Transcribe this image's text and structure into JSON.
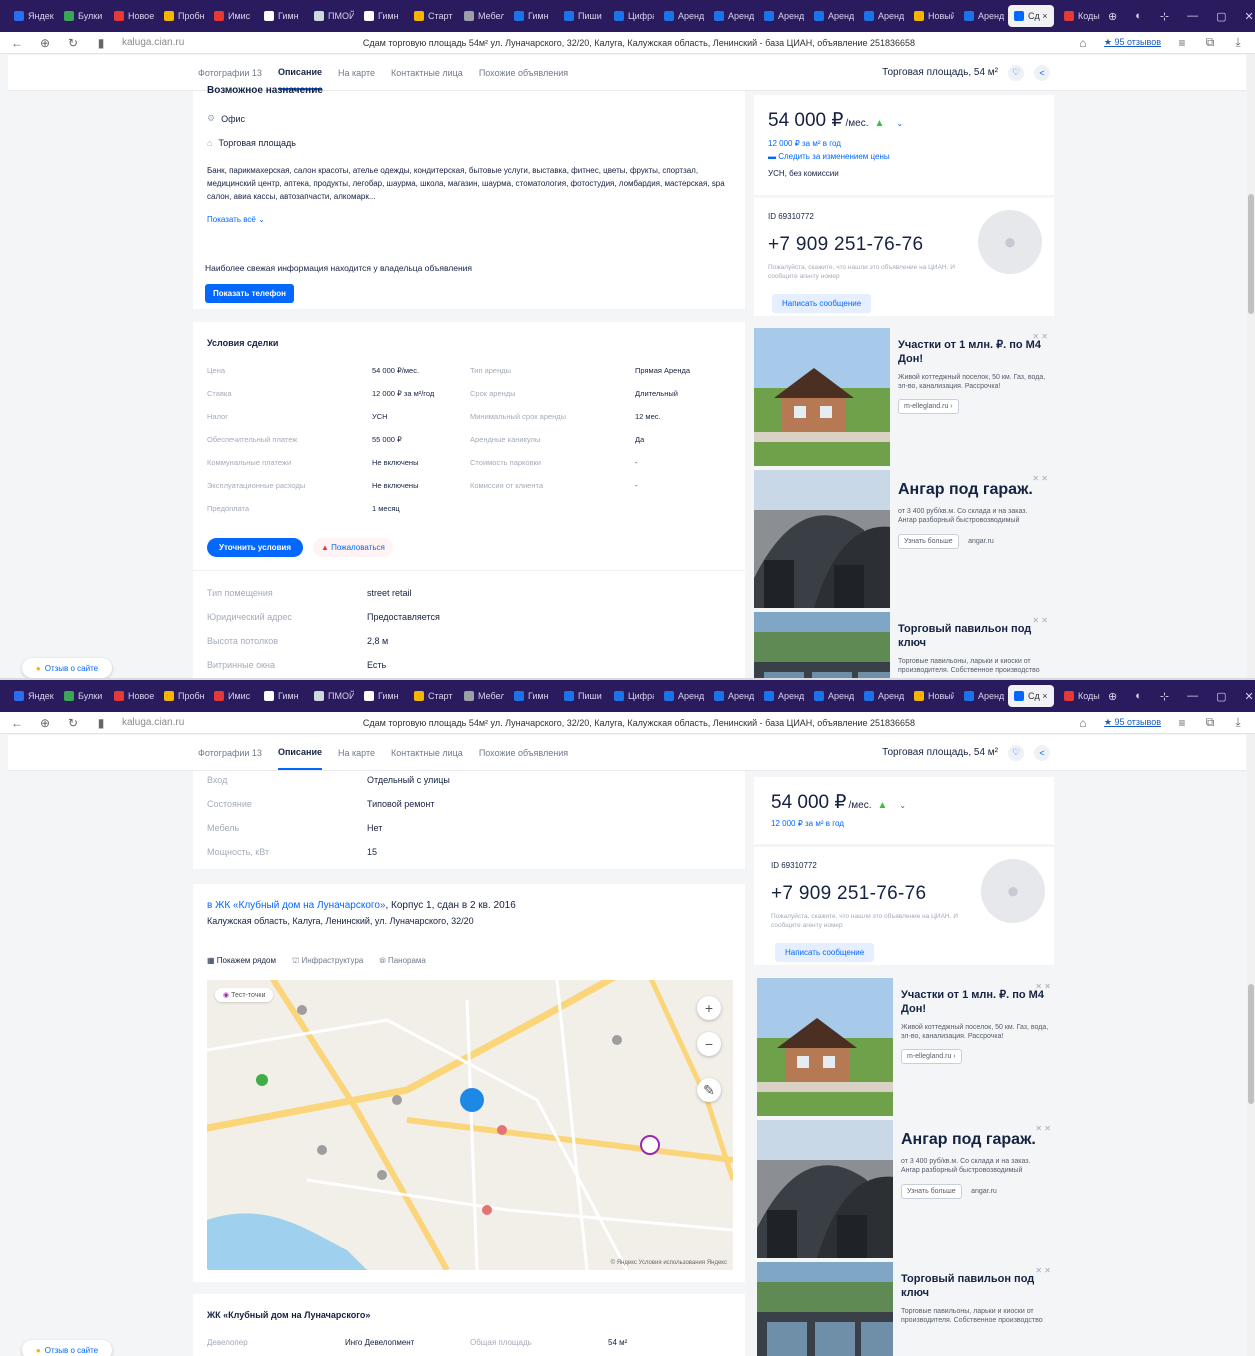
{
  "browser": {
    "tabs": [
      {
        "label": "Яндекс",
        "color": "#2b6ef0"
      },
      {
        "label": "Булки",
        "color": "#3aa757"
      },
      {
        "label": "Новое",
        "color": "#e53935"
      },
      {
        "label": "Пробнуй",
        "color": "#f5b400"
      },
      {
        "label": "Имис",
        "color": "#e53935"
      },
      {
        "label": "Гимн",
        "color": "#ffffff"
      },
      {
        "label": "ПМОЙ",
        "color": "#cfd8dc"
      },
      {
        "label": "Гимн",
        "color": "#ffffff"
      },
      {
        "label": "Старт",
        "color": "#f5b400"
      },
      {
        "label": "Мебель",
        "color": "#9aa0a6"
      },
      {
        "label": "Гимн",
        "color": "#1a73e8"
      },
      {
        "label": "Пиши",
        "color": "#1a73e8"
      },
      {
        "label": "Цифра",
        "color": "#1a73e8"
      },
      {
        "label": "Аренд",
        "color": "#1a73e8"
      },
      {
        "label": "Аренд",
        "color": "#1a73e8"
      },
      {
        "label": "Аренд",
        "color": "#1a73e8"
      },
      {
        "label": "Аренд",
        "color": "#1a73e8"
      },
      {
        "label": "Аренд",
        "color": "#1a73e8"
      },
      {
        "label": "Новый",
        "color": "#f5b400"
      },
      {
        "label": "Аренд",
        "color": "#1a73e8"
      },
      {
        "label": "Сд ×",
        "color": "#0468ff",
        "active": true
      },
      {
        "label": "Коды",
        "color": "#e53935"
      }
    ],
    "url_host": "kaluga.cian.ru",
    "page_title": "Сдам торговую площадь 54м² ул. Луначарского, 32/20, Калуга, Калужская область, Ленинский - база ЦИАН, объявление 251836658",
    "reviews_link": "★ 95 отзывов"
  },
  "nav": {
    "links": [
      "Фотографии 13",
      "Описание",
      "На карте",
      "Контактные лица",
      "Похожие объявления"
    ],
    "active_index": 1,
    "object_title": "Торговая площадь, 54 м²"
  },
  "top": {
    "section_heading": "Возможное назначение",
    "purpose_items": [
      {
        "icon": "office-icon",
        "label": "Офис"
      },
      {
        "icon": "shop-icon",
        "label": "Торговая площадь"
      }
    ],
    "purpose_text": "Банк, парикмахерская, салон красоты, ателье одежды, кондитерская, бытовые услуги, выставка, фитнес, цветы, фрукты, спортзал, медицинский центр, аптека, продукты, легобар, шаурма, школа, магазин, шаурма, стоматология, фотостудия, ломбардия, мастерская, spa салон, авиа кассы, автозапчасти, алкомарк...",
    "show_more": "Показать всё",
    "owner_note": "Наиболее свежая информация находится у владельца объявления",
    "show_phone_btn": "Показать телефон",
    "deal_heading": "Условия сделки",
    "deal_rows": [
      [
        "Цена",
        "54 000 ₽/мес.",
        "Тип аренды",
        "Прямая Аренда"
      ],
      [
        "Ставка",
        "12 000 ₽ за м²/год",
        "Срок аренды",
        "Длительный"
      ],
      [
        "Налог",
        "УСН",
        "Минимальный срок аренды",
        "12 мес."
      ],
      [
        "Обеспечительный платеж",
        "55 000 ₽",
        "Арендные каникулы",
        "Да"
      ],
      [
        "Коммунальные платежи",
        "Не включены",
        "Стоимость парковки",
        "-"
      ],
      [
        "Эксплуатационные расходы",
        "Не включены",
        "Комиссия от клиента",
        "-"
      ],
      [
        "Предоплата",
        "1 месяц",
        "",
        ""
      ]
    ],
    "clarify_btn": "Уточнить условия",
    "complain_btn": "Пожаловаться",
    "params": [
      [
        "Тип помещения",
        "street retail"
      ],
      [
        "Юридический адрес",
        "Предоставляется"
      ],
      [
        "Высота потолков",
        "2,8 м"
      ],
      [
        "Витринные окна",
        "Есть"
      ]
    ]
  },
  "bottom": {
    "params": [
      [
        "Вход",
        "Отдельный с улицы"
      ],
      [
        "Состояние",
        "Типовой ремонт"
      ],
      [
        "Мебель",
        "Нет"
      ],
      [
        "Мощность, кВт",
        "15"
      ]
    ],
    "building_link": "в ЖК «Клубный дом на Луначарского»",
    "building_info": ", Корпус 1, сдан в 2 кв. 2016",
    "address": "Калужская область, Калуга, Ленинский, ул. Луначарского, 32/20",
    "map_tabs": [
      "Покажем рядом",
      "Инфраструктура",
      "Панорама"
    ],
    "map_chip": "Тест-точки",
    "map_footer": "© Яндекс Условия использования Яндекс",
    "complex_heading": "ЖК «Клубный дом на Луначарского»",
    "complex_row": [
      "Девелопер",
      "Инго Девелопмент",
      "Общая площадь",
      "54 м²"
    ]
  },
  "sidebar": {
    "price": "54 000 ₽",
    "price_unit": "/мес.",
    "rate": "12 000 ₽ за м² в год",
    "utilities_link": "Следить за изменением цены",
    "tax": "УСН, без комиссии",
    "id_label": "ID 69310772",
    "phone": "+7 909 251-76-76",
    "phone_note": "Пожалуйста, скажите, что нашли это объявление на ЦИАН. И сообщите агенту номер",
    "message_btn": "Написать сообщение"
  },
  "ads": [
    {
      "title": "Участки от 1 млн. ₽. по М4 Дон!",
      "desc": "Живой коттеджный поселок, 50 км. Газ, вода, эл-во, канализация. Рассрочка!",
      "chip": "m-ellegland.ru ›",
      "img": "house"
    },
    {
      "title": "Ангар под гараж.",
      "desc": "от 3 400 руб/кв.м. Со склада и на заказ. Ангар разборный быстровозводимый",
      "chip": "Узнать больше",
      "chip2": "angar.ru",
      "img": "hangar"
    },
    {
      "title": "Торговый павильон под ключ",
      "desc": "Торговые павильоны, ларьки и киоски от производителя. Собственное производство",
      "chip": "",
      "img": "pavilion"
    }
  ],
  "help_button": "Отзыв о сайте",
  "colors": {
    "accent": "#0468ff",
    "text": "#152242",
    "muted": "#a3abb9",
    "tabbar": "#2a1a5e"
  }
}
